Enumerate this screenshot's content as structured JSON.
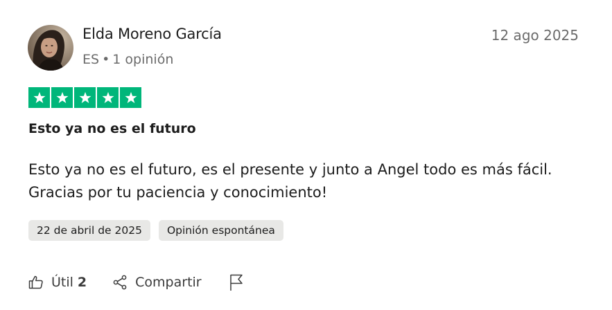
{
  "review": {
    "author_name": "Elda Moreno García",
    "country": "ES",
    "separator": "•",
    "review_count": "1 opinión",
    "date": "12 ago 2025",
    "rating": 5,
    "title": "Esto ya no es el futuro",
    "body_lines": [
      "Esto ya no es el futuro, es el presente y junto a Angel todo es más fácil.",
      "Gracias por tu paciencia y conocimiento!"
    ],
    "tags": [
      "22 de abril de 2025",
      "Opinión espontánea"
    ]
  },
  "actions": {
    "useful_label": "Útil",
    "useful_count": "2",
    "share_label": "Compartir"
  },
  "icons": {
    "thumbs_up": "thumbs-up-icon",
    "share": "share-icon",
    "flag": "flag-icon",
    "star": "star-icon"
  },
  "colors": {
    "star_green": "#00b67a",
    "tag_bg": "#e8e8e6",
    "muted_text": "#6b6b6b"
  }
}
